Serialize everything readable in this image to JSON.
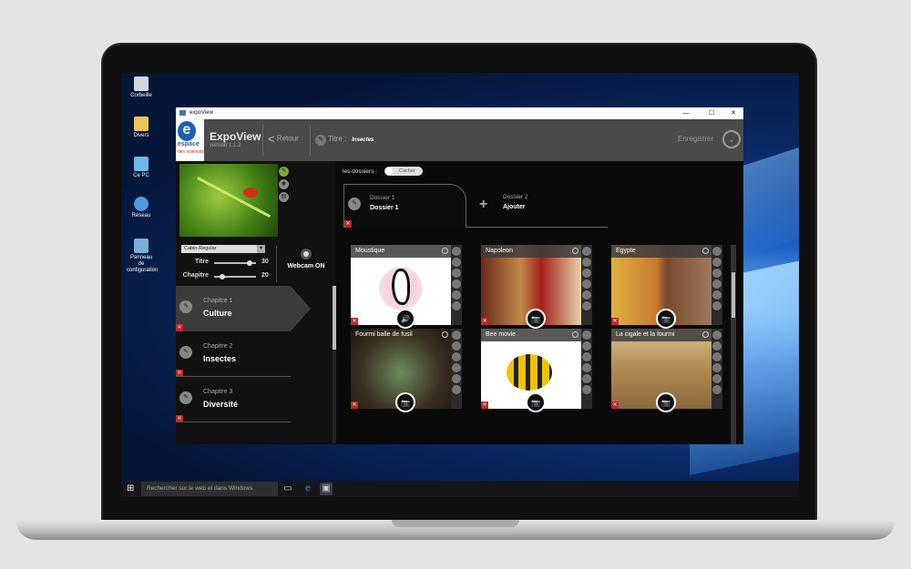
{
  "desktop": {
    "icons": [
      "Corbeille",
      "Divers",
      "Ce PC",
      "Réseau",
      "Panneau de configuration"
    ]
  },
  "taskbar": {
    "search_placeholder": "Rechercher sur le web et dans Windows"
  },
  "window": {
    "title": "expoView",
    "controls": [
      "—",
      "☐",
      "✕"
    ]
  },
  "app": {
    "logo_text": "espace des sciences",
    "name": "ExpoView",
    "version": "version 1.1.2",
    "back_label": "Retour",
    "titre_label": "Titre :",
    "titre_value": "Insectes",
    "save_label": "Enregistrer"
  },
  "editor": {
    "font": "Cabin-Regular",
    "sliders": [
      {
        "label": "Titre",
        "value": "30",
        "level": 0.82
      },
      {
        "label": "Chapitre",
        "value": "20",
        "level": 0.18
      }
    ],
    "webcam_label": "Webcam ON"
  },
  "chapters": [
    {
      "num": "Chapitre 1",
      "name": "Culture",
      "active": true
    },
    {
      "num": "Chapitre 2",
      "name": "Insectes",
      "active": false
    },
    {
      "num": "Chapitre 3",
      "name": "Diversité",
      "active": false
    }
  ],
  "folders": {
    "label": "les dossiers :",
    "toggle": "Cacher",
    "tabs": [
      {
        "title": "Dossier 1",
        "sub": "Dossier 1"
      },
      {
        "title": "Dossier 2",
        "sub": "Ajouter"
      }
    ]
  },
  "tiles": [
    {
      "title": "",
      "type": "video"
    },
    {
      "title": "",
      "type": "sound"
    },
    {
      "title": "",
      "type": "sound"
    },
    {
      "title": "Moustique",
      "type": "sound"
    },
    {
      "title": "Napoleon",
      "type": "photo"
    },
    {
      "title": "Egypte",
      "type": "photo"
    },
    {
      "title": "Fourmi balle de fusil",
      "type": "photo"
    },
    {
      "title": "Bee movie",
      "type": "photo"
    },
    {
      "title": "La cigale et la fourmi",
      "type": "photo"
    }
  ]
}
